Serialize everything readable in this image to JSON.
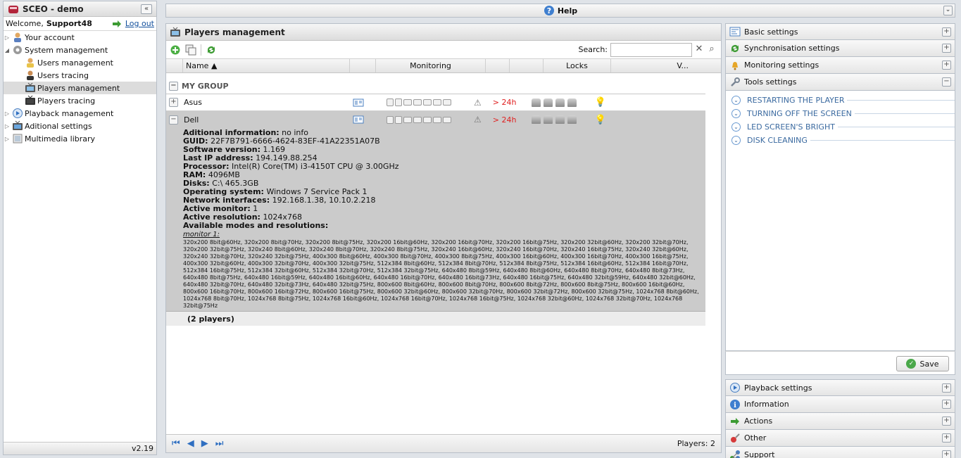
{
  "app": {
    "title": "SCEO - demo",
    "welcome_prefix": "Welcome,",
    "user": "Support48",
    "logout": "Log out",
    "version": "v2.19"
  },
  "sidebar": {
    "items": [
      {
        "label": "Your account"
      },
      {
        "label": "System management"
      },
      {
        "label": "Users management"
      },
      {
        "label": "Users tracing"
      },
      {
        "label": "Players management"
      },
      {
        "label": "Players tracing"
      },
      {
        "label": "Playback management"
      },
      {
        "label": "Aditional settings"
      },
      {
        "label": "Multimedia library"
      }
    ]
  },
  "help": {
    "title": "Help"
  },
  "center": {
    "title": "Players management",
    "search_label": "Search:",
    "search_value": "",
    "columns": {
      "name": "Name ▲",
      "monitoring": "Monitoring",
      "locks": "Locks",
      "v": "V..."
    },
    "group": "MY GROUP",
    "players": [
      {
        "name": "Asus",
        "late": "> 24h"
      },
      {
        "name": "Dell",
        "late": "> 24h"
      }
    ],
    "details": {
      "info_label": "Aditional information:",
      "info": "no info",
      "guid_label": "GUID:",
      "guid": "22F7B791-6666-4624-83EF-41A22351A07B",
      "sw_label": "Software version:",
      "sw": "1.169",
      "ip_label": "Last IP address:",
      "ip": "194.149.88.254",
      "cpu_label": "Processor:",
      "cpu": "Intel(R) Core(TM) i3-4150T CPU @ 3.00GHz",
      "ram_label": "RAM:",
      "ram": "4096MB",
      "disks_label": "Disks:",
      "disks": "C:\\ 465.3GB",
      "os_label": "Operating system:",
      "os": "Windows 7 Service Pack 1",
      "net_label": "Network interfaces:",
      "net": "192.168.1.38, 10.10.2.218",
      "mon_label": "Active monitor:",
      "mon": "1",
      "res_label": "Active resolution:",
      "res": "1024x768",
      "modes_label": "Available modes and resolutions:",
      "monitor_title": "monitor 1:",
      "modes": "320x200 8bit@60Hz, 320x200 8bit@70Hz, 320x200 8bit@75Hz, 320x200 16bit@60Hz, 320x200 16bit@70Hz, 320x200 16bit@75Hz, 320x200 32bit@60Hz, 320x200 32bit@70Hz, 320x200 32bit@75Hz, 320x240 8bit@60Hz, 320x240 8bit@70Hz, 320x240 8bit@75Hz, 320x240 16bit@60Hz, 320x240 16bit@70Hz, 320x240 16bit@75Hz, 320x240 32bit@60Hz, 320x240 32bit@70Hz, 320x240 32bit@75Hz, 400x300 8bit@60Hz, 400x300 8bit@70Hz, 400x300 8bit@75Hz, 400x300 16bit@60Hz, 400x300 16bit@70Hz, 400x300 16bit@75Hz, 400x300 32bit@60Hz, 400x300 32bit@70Hz, 400x300 32bit@75Hz, 512x384 8bit@60Hz, 512x384 8bit@70Hz, 512x384 8bit@75Hz, 512x384 16bit@60Hz, 512x384 16bit@70Hz, 512x384 16bit@75Hz, 512x384 32bit@60Hz, 512x384 32bit@70Hz, 512x384 32bit@75Hz, 640x480 8bit@59Hz, 640x480 8bit@60Hz, 640x480 8bit@70Hz, 640x480 8bit@73Hz, 640x480 8bit@75Hz, 640x480 16bit@59Hz, 640x480 16bit@60Hz, 640x480 16bit@70Hz, 640x480 16bit@73Hz, 640x480 16bit@75Hz, 640x480 32bit@59Hz, 640x480 32bit@60Hz, 640x480 32bit@70Hz, 640x480 32bit@73Hz, 640x480 32bit@75Hz, 800x600 8bit@60Hz, 800x600 8bit@70Hz, 800x600 8bit@72Hz, 800x600 8bit@75Hz, 800x600 16bit@60Hz, 800x600 16bit@70Hz, 800x600 16bit@72Hz, 800x600 16bit@75Hz, 800x600 32bit@60Hz, 800x600 32bit@70Hz, 800x600 32bit@72Hz, 800x600 32bit@75Hz, 1024x768 8bit@60Hz, 1024x768 8bit@70Hz, 1024x768 8bit@75Hz, 1024x768 16bit@60Hz, 1024x768 16bit@70Hz, 1024x768 16bit@75Hz, 1024x768 32bit@60Hz, 1024x768 32bit@70Hz, 1024x768 32bit@75Hz"
    },
    "count": "(2 players)",
    "pager_count": "Players:  2"
  },
  "right": {
    "basic": "Basic settings",
    "sync": "Synchronisation settings",
    "monitoring": "Monitoring settings",
    "tools": "Tools settings",
    "tool_items": [
      "RESTARTING THE PLAYER",
      "TURNING OFF THE SCREEN",
      "LED SCREEN'S BRIGHT",
      "DISK CLEANING"
    ],
    "save": "Save",
    "playback": "Playback settings",
    "information": "Information",
    "actions": "Actions",
    "other": "Other",
    "support": "Support"
  }
}
